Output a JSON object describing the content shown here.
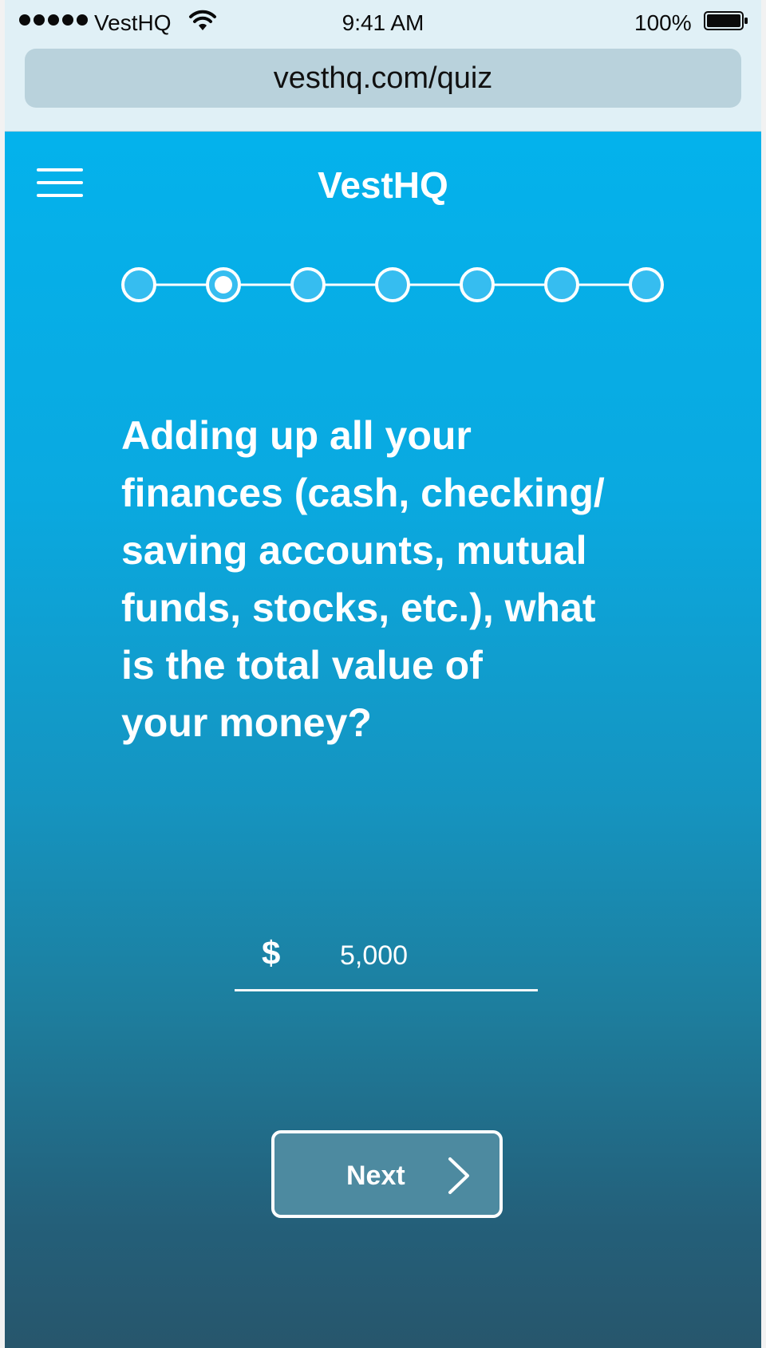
{
  "status_bar": {
    "carrier": "VestHQ",
    "time": "9:41 AM",
    "battery": "100%"
  },
  "browser": {
    "url": "vesthq.com/quiz"
  },
  "header": {
    "brand": "VestHQ",
    "menu_icon": "hamburger-menu-icon"
  },
  "progress": {
    "total_steps": 7,
    "current_step": 2
  },
  "question": {
    "lines": [
      "Adding up all your",
      "finances (cash, checking/",
      "saving accounts, mutual",
      "funds, stocks, etc.), what",
      "is the total value of",
      "your money?"
    ]
  },
  "answer": {
    "currency": "$",
    "value": "5,000"
  },
  "actions": {
    "next_label": "Next",
    "next_icon": "chevron-right-icon"
  },
  "colors": {
    "accent": "#04b2ec",
    "bottom": "#27566c",
    "progress_fill": "#36bdf0",
    "button_fill": "#4d8aa0"
  }
}
